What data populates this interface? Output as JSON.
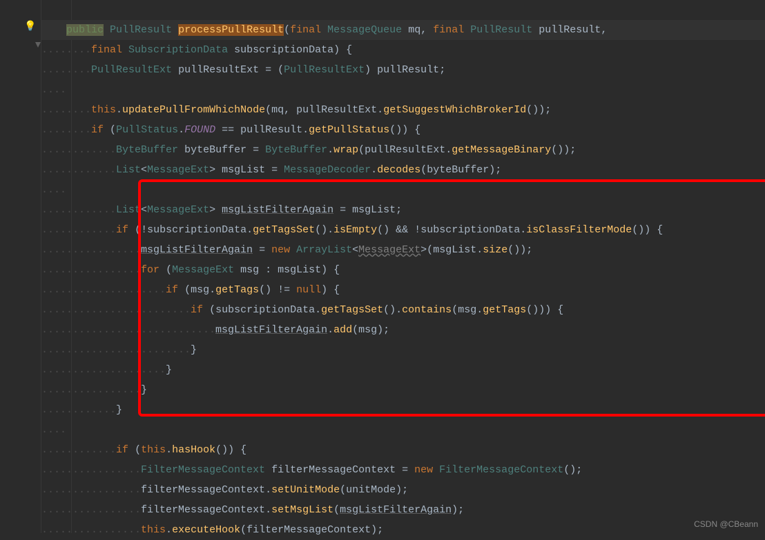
{
  "watermark": "CSDN @CBeann",
  "code": {
    "l1": {
      "kw_public": "public",
      "type1": "PullResult",
      "method": "processPullResult",
      "kw_final": "final",
      "type2": "MessageQueue",
      "p1": "mq",
      "type3": "PullResult",
      "p2": "pullResult"
    },
    "l2": {
      "kw_final": "final",
      "type": "SubscriptionData",
      "p": "subscriptionData"
    },
    "l3": {
      "type": "PullResultExt",
      "v": "pullResultExt",
      "cast": "PullResultExt",
      "src": "pullResult"
    },
    "l5": {
      "this": "this",
      "m1": "updatePullFromWhichNode",
      "a1": "mq",
      "a2": "pullResultExt",
      "m2": "getSuggestWhichBrokerId"
    },
    "l6": {
      "kw_if": "if",
      "type": "PullStatus",
      "enum": "FOUND",
      "v": "pullResult",
      "m": "getPullStatus"
    },
    "l7": {
      "type1": "ByteBuffer",
      "v": "byteBuffer",
      "type2": "ByteBuffer",
      "m1": "wrap",
      "a": "pullResultExt",
      "m2": "getMessageBinary"
    },
    "l8": {
      "type1": "List",
      "gen": "MessageExt",
      "v": "msgList",
      "type2": "MessageDecoder",
      "m": "decodes",
      "a": "byteBuffer"
    },
    "l10": {
      "type1": "List",
      "gen": "MessageExt",
      "v": "msgListFilterAgain",
      "src": "msgList"
    },
    "l11": {
      "kw_if": "if",
      "a1": "subscriptionData",
      "m1": "getTagsSet",
      "m2": "isEmpty",
      "a2": "subscriptionData",
      "m3": "isClassFilterMode"
    },
    "l12": {
      "v": "msgListFilterAgain",
      "kw_new": "new",
      "type": "ArrayList",
      "gen": "MessageExt",
      "a": "msgList",
      "m": "size"
    },
    "l13": {
      "kw_for": "for",
      "type": "MessageExt",
      "v": "msg",
      "src": "msgList"
    },
    "l14": {
      "kw_if": "if",
      "a": "msg",
      "m": "getTags",
      "kw_null": "null"
    },
    "l15": {
      "kw_if": "if",
      "a1": "subscriptionData",
      "m1": "getTagsSet",
      "m2": "contains",
      "a2": "msg",
      "m3": "getTags"
    },
    "l16": {
      "v": "msgListFilterAgain",
      "m": "add",
      "a": "msg"
    },
    "l22": {
      "kw_if": "if",
      "this": "this",
      "m": "hasHook"
    },
    "l23": {
      "type": "FilterMessageContext",
      "v": "filterMessageContext",
      "kw_new": "new",
      "type2": "FilterMessageContext"
    },
    "l24": {
      "a": "filterMessageContext",
      "m": "setUnitMode",
      "p": "unitMode"
    },
    "l25": {
      "a": "filterMessageContext",
      "m": "setMsgList",
      "p": "msgListFilterAgain"
    },
    "l26": {
      "this": "this",
      "m": "executeHook",
      "a": "filterMessageContext"
    }
  }
}
